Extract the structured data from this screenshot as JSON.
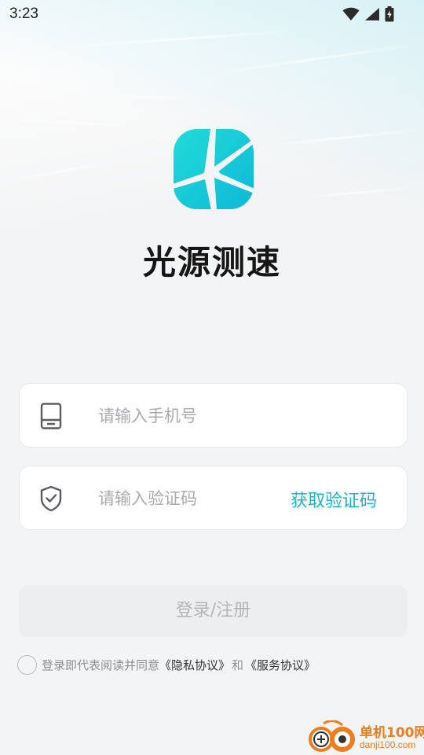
{
  "status_bar": {
    "time": "3:23",
    "icons": [
      "wifi-icon",
      "cellular-signal-icon",
      "battery-charging-icon"
    ]
  },
  "app": {
    "name": "光源测速",
    "logo_colors": {
      "primary": "#1fd3d9",
      "secondary": "#0fb9d6"
    }
  },
  "phone_field": {
    "icon": "phone-icon",
    "placeholder": "请输入手机号",
    "value": ""
  },
  "code_field": {
    "icon": "shield-check-icon",
    "placeholder": "请输入验证码",
    "value": "",
    "get_code_label": "获取验证码"
  },
  "login_button": {
    "label": "登录/注册",
    "enabled": false
  },
  "agreement": {
    "checked": false,
    "prefix": "登录即代表阅读并同意",
    "privacy_link": "《隐私协议》",
    "conjunction": "和",
    "service_link": "《服务协议》"
  },
  "watermark": {
    "text_cn": "单机100网",
    "text_en": "danji100.com"
  },
  "colors": {
    "accent": "#1fb5c2",
    "background": "#f3f4f5",
    "watermark": "#f07d1d"
  }
}
